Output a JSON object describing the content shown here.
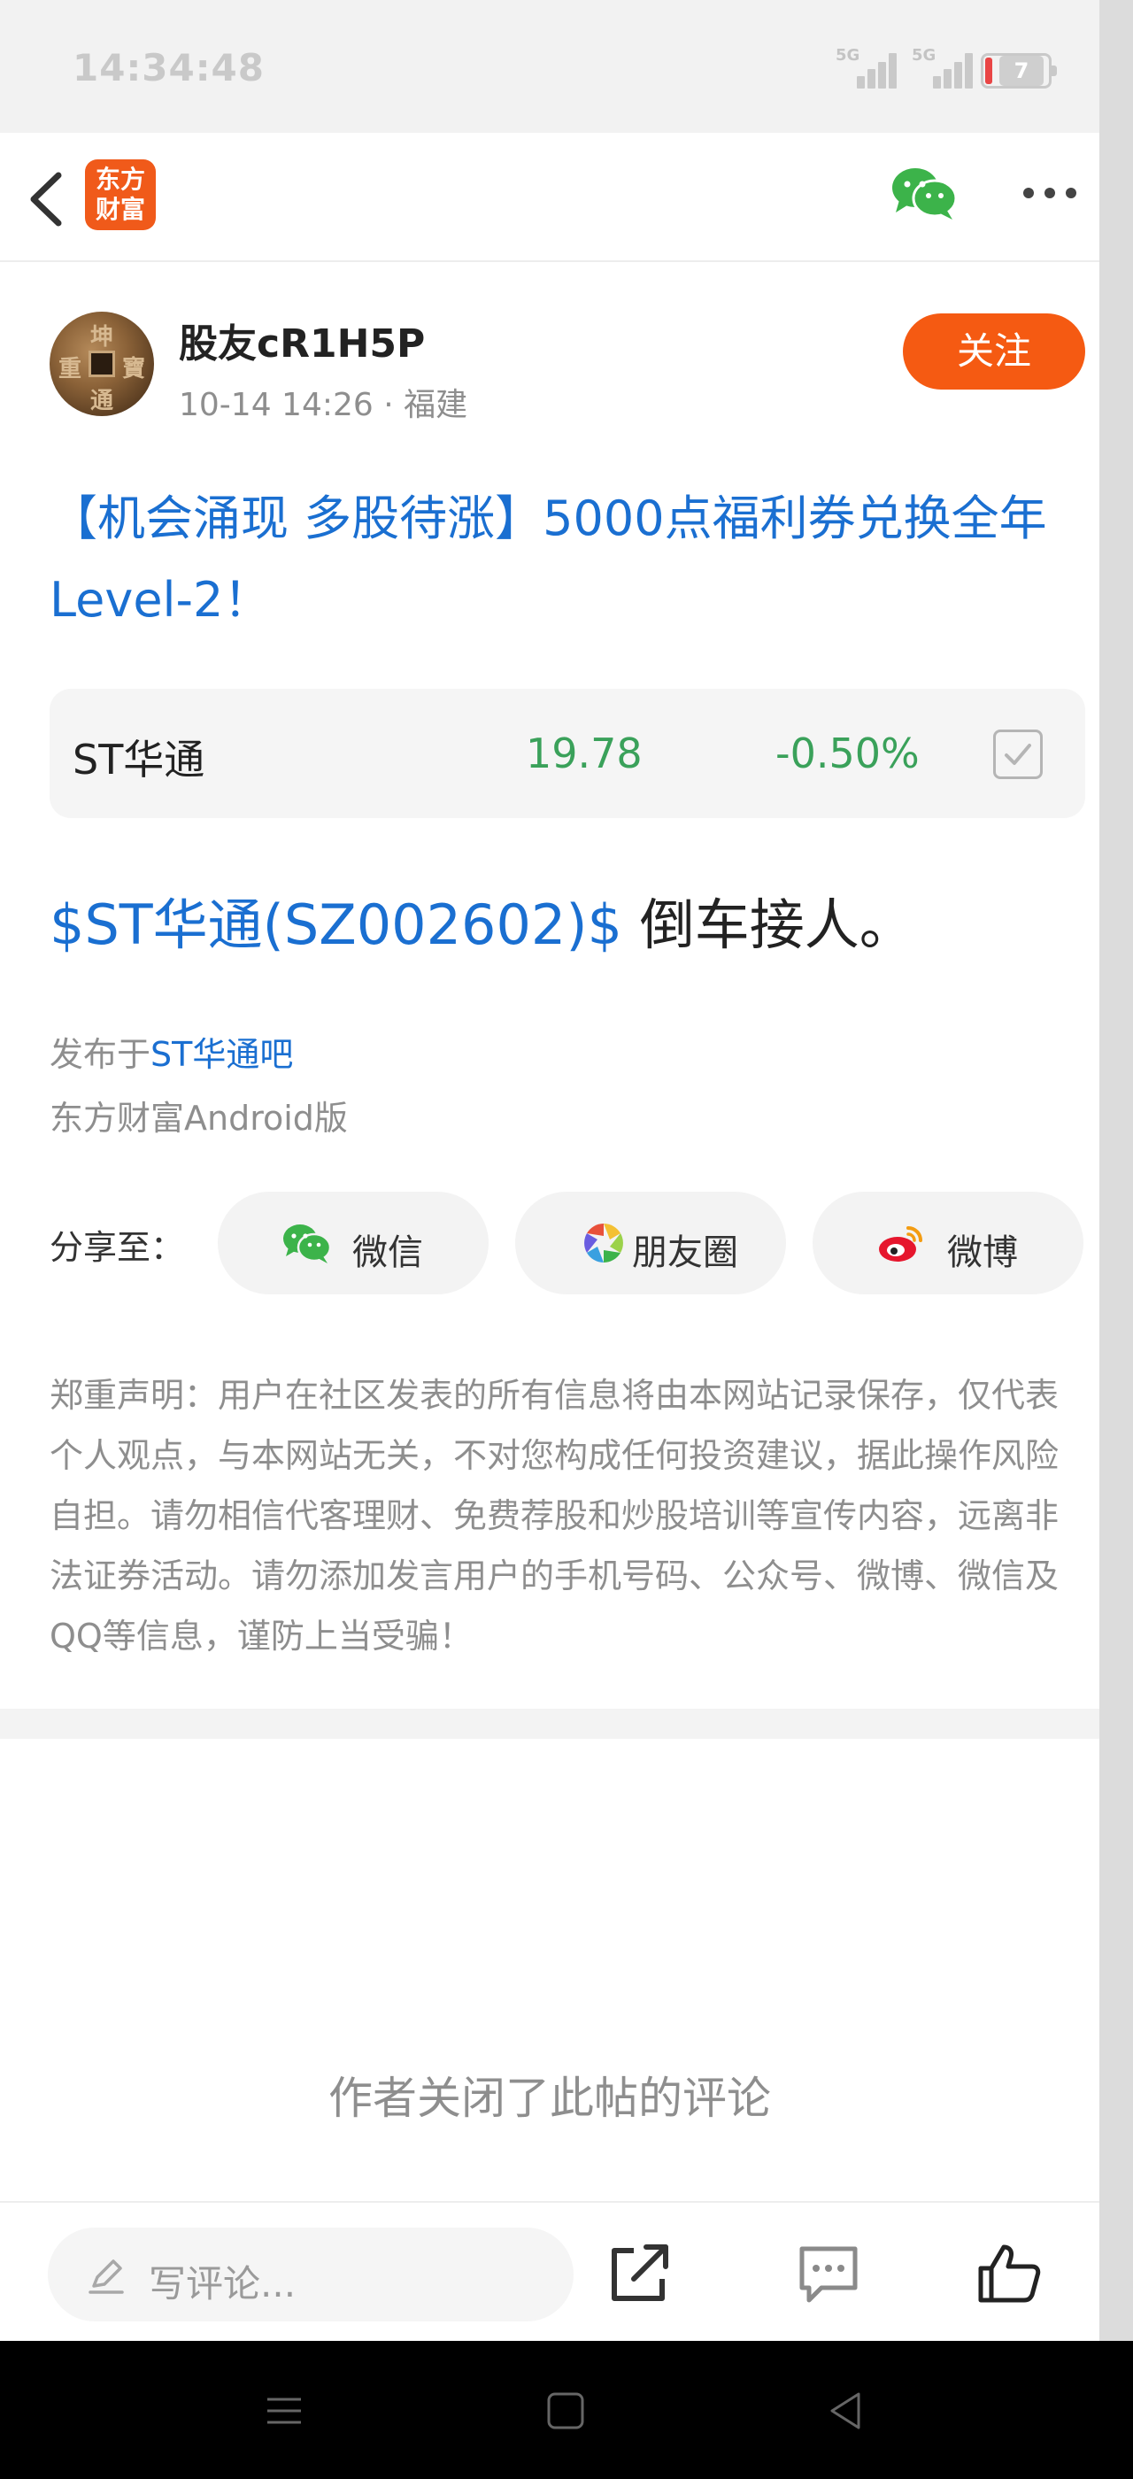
{
  "status_bar": {
    "time": "14:34:48",
    "signal_1": "5G",
    "signal_2": "5G",
    "battery": "7"
  },
  "header": {
    "logo_line1": "东方",
    "logo_line2": "财富",
    "icons": [
      "back-icon",
      "wechat-icon",
      "more-icon"
    ]
  },
  "author": {
    "name": "股友cR1H5P",
    "time": "10-14 14:26",
    "separator": "·",
    "location": "福建",
    "follow_label": "关注"
  },
  "post": {
    "title": "【机会涌现 多股待涨】5000点福利券兑换全年Level-2！",
    "stock": {
      "name": "ST华通",
      "price": "19.78",
      "change": "-0.50%",
      "color": "#3aa15a"
    },
    "body_link": "$ST华通(SZ002602)$",
    "body_text": " 倒车接人。",
    "posted_in_prefix": "发布于",
    "posted_in_bar": "ST华通吧",
    "client": "东方财富Android版"
  },
  "share": {
    "label": "分享至：",
    "targets": [
      {
        "label": "微信",
        "icon": "wechat-icon"
      },
      {
        "label": "朋友圈",
        "icon": "moments-icon"
      },
      {
        "label": "微博",
        "icon": "weibo-icon"
      }
    ]
  },
  "disclaimer": "郑重声明：用户在社区发表的所有信息将由本网站记录保存，仅代表个人观点，与本网站无关，不对您构成任何投资建议，据此操作风险自担。请勿相信代客理财、免费荐股和炒股培训等宣传内容，远离非法证券活动。请勿添加发言用户的手机号码、公众号、微博、微信及QQ等信息，谨防上当受骗！",
  "comments_closed": "作者关闭了此帖的评论",
  "bottom_bar": {
    "comment_placeholder": "写评论...",
    "icons": [
      "share-icon",
      "comment-icon",
      "like-icon"
    ]
  },
  "colors": {
    "brand_orange": "#f55a12",
    "link_blue": "#1a6fd1",
    "stock_down_green": "#3aa15a"
  }
}
